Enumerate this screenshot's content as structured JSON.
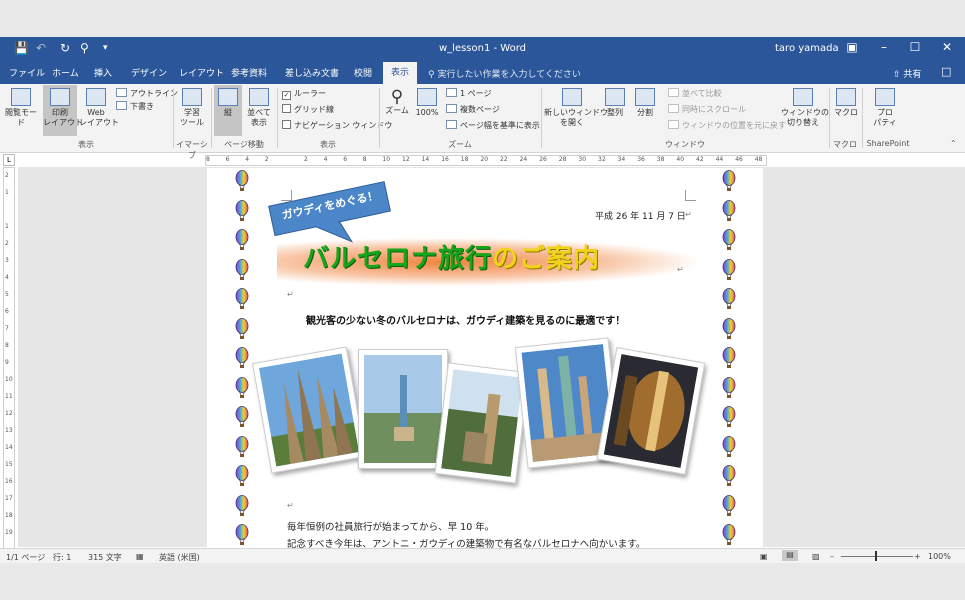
{
  "title_bar": {
    "doc_title": "w_lesson1 - Word",
    "user": "taro yamada"
  },
  "tabs": [
    "ファイル",
    "ホーム",
    "挿入",
    "デザイン",
    "レイアウト",
    "参考資料",
    "差し込み文書",
    "校閲",
    "表示"
  ],
  "active_tab": "表示",
  "tell_me": "実行したい作業を入力してください",
  "share": "共有",
  "ribbon": {
    "views": {
      "read_mode": "閲覧モード",
      "print_layout": "印刷\nレイアウト",
      "web_layout": "Web\nレイアウト",
      "outline": "アウトライン",
      "draft": "下書き",
      "group": "表示"
    },
    "immersive": {
      "learning_tools": "学習\nツール",
      "group": "イマーシブ"
    },
    "page_movement": {
      "vertical": "縦",
      "side_by_side": "並べて\n表示",
      "group": "ページ移動"
    },
    "show": {
      "ruler": "ルーラー",
      "gridlines": "グリッド線",
      "nav_pane": "ナビゲーション ウィンドウ",
      "group": "表示"
    },
    "zoom": {
      "zoom": "ズーム",
      "percent": "100%",
      "one_page": "1 ページ",
      "multiple_pages": "複数ページ",
      "page_width": "ページ幅を基準に表示",
      "group": "ズーム"
    },
    "window": {
      "new_window": "新しいウィンドウ\nを開く",
      "arrange": "整列",
      "split": "分割",
      "side_by_side": "並べて比較",
      "sync_scroll": "同時にスクロール",
      "reset_position": "ウィンドウの位置を元に戻す",
      "switch": "ウィンドウの\n切り替え",
      "group": "ウィンドウ"
    },
    "macros": {
      "macros": "マクロ",
      "group": "マクロ"
    },
    "sharepoint": {
      "properties": "プロ\nパティ",
      "group": "SharePoint"
    }
  },
  "ruler_ticks": [
    "8",
    "6",
    "4",
    "2",
    "",
    "2",
    "4",
    "6",
    "8",
    "10",
    "12",
    "14",
    "16",
    "18",
    "20",
    "22",
    "24",
    "26",
    "28",
    "30",
    "32",
    "34",
    "36",
    "38",
    "40",
    "42",
    "44",
    "46",
    "48"
  ],
  "vruler_ticks": [
    "2",
    "1",
    "",
    "1",
    "2",
    "3",
    "4",
    "5",
    "6",
    "7",
    "8",
    "9",
    "10",
    "11",
    "12",
    "13",
    "14",
    "15",
    "16",
    "17",
    "18",
    "19"
  ],
  "document": {
    "date": "平成 26 年 11 月 7 日",
    "callout": "ガウディをめぐる！",
    "title_green": "バルセロナ旅行",
    "title_yellow": "のご案内",
    "subtitle": "観光客の少ない冬のバルセロナは、ガウディ建築を見るのに最適です！",
    "body_line1": "毎年恒例の社員旅行が始まってから、早 10 年。",
    "body_line2": "記念すべき今年は、アントニ・ガウディの建築物で有名なバルセロナへ向かいます。"
  },
  "status_bar": {
    "page": "1/1 ページ",
    "line": "行: 1",
    "chars": "315 文字",
    "language": "英語 (米国)",
    "zoom": "100%"
  },
  "colors": {
    "word_blue": "#2b579a",
    "title_green": "#17a51a",
    "title_yellow": "#f2d21b",
    "callout_blue": "#4a86c8",
    "glow_orange": "#ee6e1e"
  }
}
